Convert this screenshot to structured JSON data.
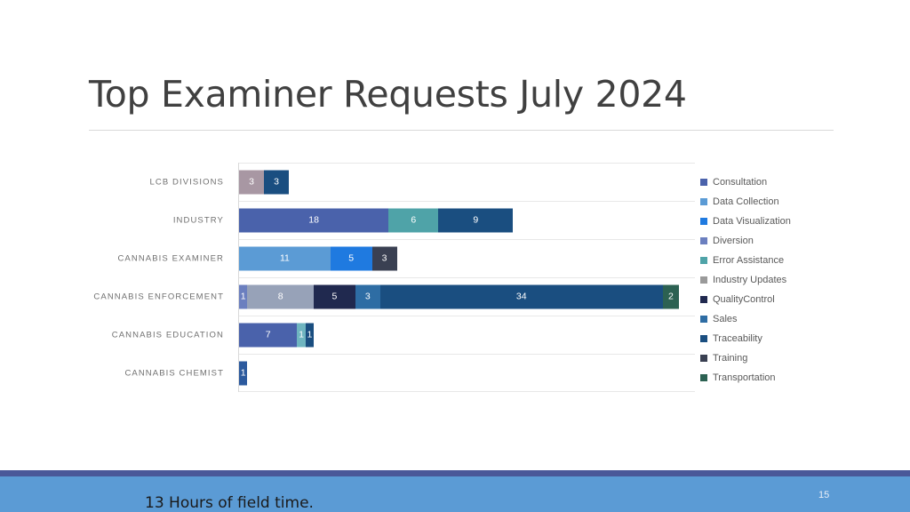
{
  "slide": {
    "title": "Top Examiner Requests July 2024",
    "footer_text": "13 Hours of field time.",
    "slide_number": "15",
    "banner_stripe_color": "#4a5899",
    "banner_body_color": "#5b9bd5"
  },
  "chart_data": {
    "type": "bar",
    "orientation": "horizontal",
    "stacked": true,
    "title": "Top Examiner Requests July 2024",
    "xlabel": "",
    "ylabel": "",
    "grid": true,
    "legend_position": "right",
    "xlim": [
      0,
      55
    ],
    "categories": [
      "LCB DIVISIONS",
      "INDUSTRY",
      "CANNABIS EXAMINER",
      "CANNABIS ENFORCEMENT",
      "CANNABIS EDUCATION",
      "CANNABIS CHEMIST"
    ],
    "series": [
      {
        "name": "Consultation",
        "color": "#4a62ab",
        "values": [
          0,
          18,
          0,
          0,
          7,
          1
        ]
      },
      {
        "name": "Data Collection",
        "color": "#5b9bd5",
        "values": [
          0,
          0,
          11,
          0,
          0,
          0
        ]
      },
      {
        "name": "Data Visualization",
        "color": "#1f7ae0",
        "values": [
          0,
          0,
          5,
          0,
          0,
          0
        ]
      },
      {
        "name": "Diversion",
        "color": "#6b7fbf",
        "values": [
          0,
          0,
          0,
          1,
          0,
          0
        ]
      },
      {
        "name": "Error Assistance",
        "color": "#4fa3a8",
        "values": [
          0,
          6,
          0,
          0,
          1,
          0
        ]
      },
      {
        "name": "Industry Updates",
        "color": "#a897a3",
        "values": [
          3,
          0,
          0,
          8,
          0,
          0
        ]
      },
      {
        "name": "QualityControl",
        "color": "#20294f",
        "values": [
          0,
          0,
          0,
          5,
          0,
          0
        ]
      },
      {
        "name": "Sales",
        "color": "#2e6da4",
        "values": [
          0,
          0,
          0,
          3,
          0,
          0
        ]
      },
      {
        "name": "Traceability",
        "color": "#1a4e80",
        "values": [
          3,
          9,
          0,
          34,
          1,
          0
        ]
      },
      {
        "name": "Training",
        "color": "#3a4052",
        "values": [
          0,
          0,
          3,
          0,
          0,
          0
        ]
      },
      {
        "name": "Transportation",
        "color": "#2c6152",
        "values": [
          0,
          0,
          0,
          2,
          0,
          0
        ]
      }
    ],
    "rows": [
      {
        "category": "LCB DIVISIONS",
        "segments": [
          {
            "series": "Industry Updates",
            "value": 3,
            "color": "#a897a3"
          },
          {
            "series": "Traceability",
            "value": 3,
            "color": "#1a4e80"
          }
        ]
      },
      {
        "category": "INDUSTRY",
        "segments": [
          {
            "series": "Consultation",
            "value": 18,
            "color": "#4a62ab"
          },
          {
            "series": "Error Assistance",
            "value": 6,
            "color": "#4fa3a8"
          },
          {
            "series": "Traceability",
            "value": 9,
            "color": "#1a4e80"
          }
        ]
      },
      {
        "category": "CANNABIS EXAMINER",
        "segments": [
          {
            "series": "Data Collection",
            "value": 11,
            "color": "#5b9bd5"
          },
          {
            "series": "Data Visualization",
            "value": 5,
            "color": "#1f7ae0"
          },
          {
            "series": "Training",
            "value": 3,
            "color": "#3a4052"
          }
        ]
      },
      {
        "category": "CANNABIS ENFORCEMENT",
        "segments": [
          {
            "series": "Diversion",
            "value": 1,
            "color": "#6b7fbf"
          },
          {
            "series": "Industry Updates",
            "value": 8,
            "color": "#97a2b8"
          },
          {
            "series": "QualityControl",
            "value": 5,
            "color": "#20294f"
          },
          {
            "series": "Sales",
            "value": 3,
            "color": "#2e6da4"
          },
          {
            "series": "Traceability",
            "value": 34,
            "color": "#1a4e80"
          },
          {
            "series": "Transportation",
            "value": 2,
            "color": "#2c6152"
          }
        ]
      },
      {
        "category": "CANNABIS EDUCATION",
        "segments": [
          {
            "series": "Consultation",
            "value": 7,
            "color": "#4a62ab"
          },
          {
            "series": "Error Assistance",
            "value": 1,
            "color": "#6fb5c0"
          },
          {
            "series": "Traceability",
            "value": 1,
            "color": "#1a4e80"
          }
        ]
      },
      {
        "category": "CANNABIS CHEMIST",
        "segments": [
          {
            "series": "Consultation",
            "value": 1,
            "color": "#2c5a9e"
          }
        ]
      }
    ],
    "legend": [
      {
        "label": "Consultation",
        "color": "#4a62ab"
      },
      {
        "label": "Data Collection",
        "color": "#5b9bd5"
      },
      {
        "label": "Data Visualization",
        "color": "#1f7ae0"
      },
      {
        "label": "Diversion",
        "color": "#6b7fbf"
      },
      {
        "label": "Error Assistance",
        "color": "#4fa3a8"
      },
      {
        "label": "Industry Updates",
        "color": "#9a9a9a"
      },
      {
        "label": "QualityControl",
        "color": "#20294f"
      },
      {
        "label": "Sales",
        "color": "#2e6da4"
      },
      {
        "label": "Traceability",
        "color": "#1a4e80"
      },
      {
        "label": "Training",
        "color": "#3a4052"
      },
      {
        "label": "Transportation",
        "color": "#2c6152"
      }
    ]
  }
}
